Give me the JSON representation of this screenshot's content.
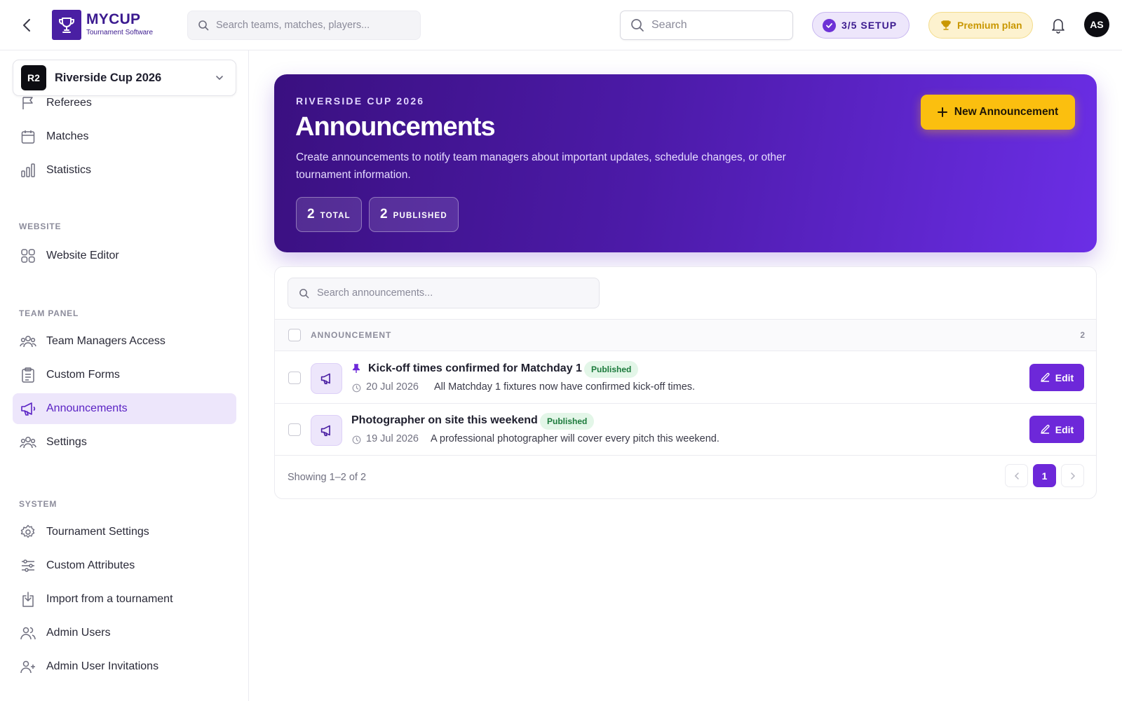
{
  "header": {
    "brand_title": "MYCUP",
    "brand_subtitle": "Tournament Software",
    "search_placeholder": "Search teams, matches, players...",
    "search2_placeholder": "Search",
    "setup_label": "3/5 SETUP",
    "premium_label": "Premium plan",
    "avatar_initials": "AS"
  },
  "sidebar": {
    "tournament": {
      "badge": "R2",
      "name": "Riverside Cup 2026"
    },
    "items_top": [
      {
        "label": "Referees",
        "icon": "flag-icon"
      },
      {
        "label": "Matches",
        "icon": "calendar-icon"
      },
      {
        "label": "Statistics",
        "icon": "bar-chart-icon"
      }
    ],
    "section_website": "WEBSITE",
    "items_website": [
      {
        "label": "Website Editor",
        "icon": "grid-icon"
      }
    ],
    "section_team_panel": "TEAM PANEL",
    "items_team": [
      {
        "label": "Team Managers Access",
        "icon": "users-group-icon"
      },
      {
        "label": "Custom Forms",
        "icon": "clipboard-icon"
      },
      {
        "label": "Announcements",
        "icon": "megaphone-icon",
        "active": true
      },
      {
        "label": "Settings",
        "icon": "users-group-icon"
      }
    ],
    "section_system": "SYSTEM",
    "items_system": [
      {
        "label": "Tournament Settings",
        "icon": "gear-icon"
      },
      {
        "label": "Custom Attributes",
        "icon": "sliders-icon"
      },
      {
        "label": "Import from a tournament",
        "icon": "import-icon"
      },
      {
        "label": "Admin Users",
        "icon": "users-icon"
      },
      {
        "label": "Admin User Invitations",
        "icon": "user-plus-icon"
      }
    ]
  },
  "hero": {
    "eyebrow": "RIVERSIDE CUP 2026",
    "title": "Announcements",
    "description": "Create announcements to notify team managers about important updates, schedule changes, or other tournament information.",
    "stats": [
      {
        "value": "2",
        "label": "TOTAL"
      },
      {
        "value": "2",
        "label": "PUBLISHED"
      }
    ],
    "new_button": "New Announcement"
  },
  "table": {
    "search_placeholder": "Search announcements...",
    "column_header": "ANNOUNCEMENT",
    "count": "2",
    "rows": [
      {
        "title": "Kick-off times confirmed for Matchday 1",
        "pinned": true,
        "status": "Published",
        "date": "20 Jul 2026",
        "summary": "All Matchday 1 fixtures now have confirmed kick-off times.",
        "edit_label": "Edit"
      },
      {
        "title": "Photographer on site this weekend",
        "pinned": false,
        "status": "Published",
        "date": "19 Jul 2026",
        "summary": "A professional photographer will cover every pitch this weekend.",
        "edit_label": "Edit"
      }
    ],
    "showing": "Showing 1–2 of 2",
    "current_page": "1"
  },
  "colors": {
    "accent": "#6d28d9",
    "accent_light": "#ede6fb",
    "brand": "#4a1fa3",
    "warning": "#fbbf0f",
    "success_bg": "#e3f6e8",
    "success_text": "#1c7a3c"
  }
}
